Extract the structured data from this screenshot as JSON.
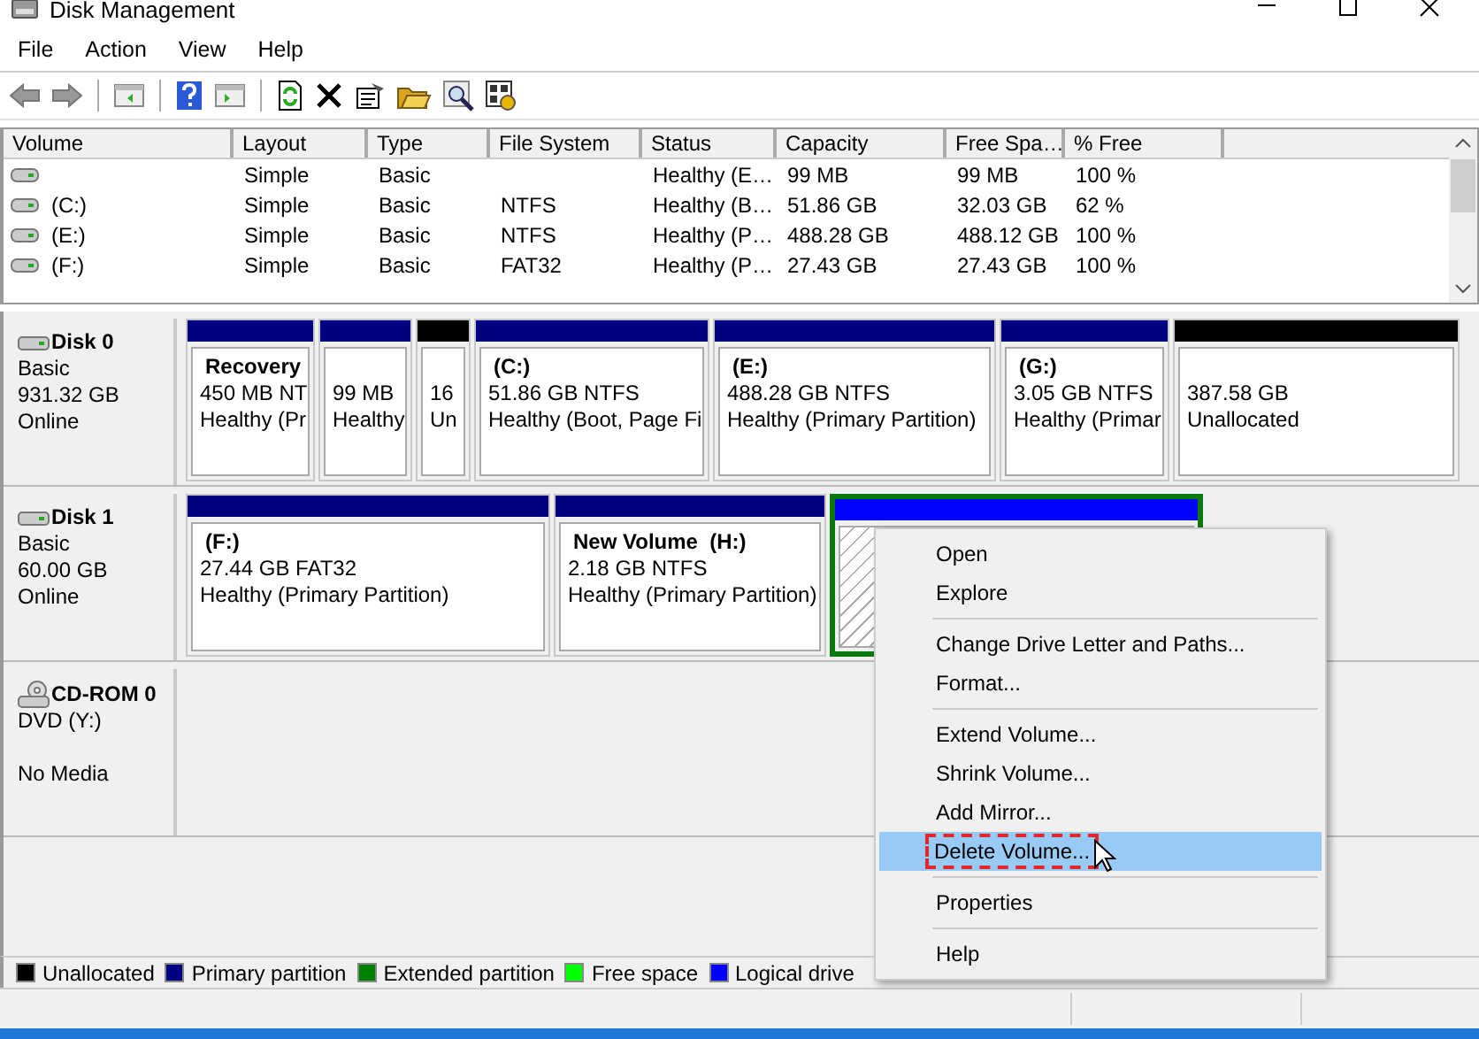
{
  "window": {
    "title": "Disk Management"
  },
  "menu": [
    "File",
    "Action",
    "View",
    "Help"
  ],
  "volume_list": {
    "columns": [
      "Volume",
      "Layout",
      "Type",
      "File System",
      "Status",
      "Capacity",
      "Free Spa…",
      "% Free"
    ],
    "rows": [
      [
        "",
        "Simple",
        "Basic",
        "",
        "Healthy (E…",
        "99 MB",
        "99 MB",
        "100 %"
      ],
      [
        "(C:)",
        "Simple",
        "Basic",
        "NTFS",
        "Healthy (B…",
        "51.86 GB",
        "32.03 GB",
        "62 %"
      ],
      [
        "(E:)",
        "Simple",
        "Basic",
        "NTFS",
        "Healthy (P…",
        "488.28 GB",
        "488.12 GB",
        "100 %"
      ],
      [
        "(F:)",
        "Simple",
        "Basic",
        "FAT32",
        "Healthy (P…",
        "27.43 GB",
        "27.43 GB",
        "100 %"
      ]
    ]
  },
  "disks": [
    {
      "kind": "disk",
      "name": "Disk 0",
      "type": "Basic",
      "size": "931.32 GB",
      "status": "Online",
      "partitions": [
        {
          "kind": "primary",
          "color": "#000080",
          "title": "Recovery",
          "size": "450 MB NT",
          "status": "Healthy (Pr",
          "selected": false
        },
        {
          "kind": "primary",
          "color": "#000080",
          "size": "99 MB",
          "status": "Healthy",
          "selected": false
        },
        {
          "kind": "primary",
          "color": "#000000",
          "size": "16",
          "status": "Un",
          "selected": false
        },
        {
          "kind": "primary",
          "color": "#000080",
          "title": "(C:)",
          "size": "51.86 GB NTFS",
          "status": "Healthy (Boot, Page Fi",
          "selected": false
        },
        {
          "kind": "primary",
          "color": "#000080",
          "title": "(E:)",
          "size": "488.28 GB NTFS",
          "status": "Healthy (Primary Partition)",
          "selected": false
        },
        {
          "kind": "primary",
          "color": "#000080",
          "title": "(G:)",
          "size": "3.05 GB NTFS",
          "status": "Healthy (Primar",
          "selected": false
        },
        {
          "kind": "primary",
          "color": "#000000",
          "size": "387.58 GB",
          "status": "Unallocated",
          "selected": false
        }
      ]
    },
    {
      "kind": "disk",
      "name": "Disk 1",
      "type": "Basic",
      "size": "60.00 GB",
      "status": "Online",
      "partitions": [
        {
          "kind": "primary",
          "color": "#000080",
          "title": "(F:)",
          "size": "27.44 GB FAT32",
          "status": "Healthy (Primary Partition)",
          "selected": false
        },
        {
          "kind": "primary",
          "color": "#000080",
          "title": "New Volume  (H:)",
          "size": "2.18 GB NTFS",
          "status": "Healthy (Primary Partition)",
          "selected": false
        },
        {
          "kind": "logical",
          "color": "#0000ff",
          "selected": true
        }
      ]
    },
    {
      "kind": "cdrom",
      "name": "CD-ROM 0",
      "type": "DVD (Y:)",
      "status": "No Media"
    }
  ],
  "legend": [
    {
      "label": "Unallocated",
      "color": "#000000"
    },
    {
      "label": "Primary partition",
      "color": "#000080"
    },
    {
      "label": "Extended partition",
      "color": "#008000"
    },
    {
      "label": "Free space",
      "color": "#00ff00"
    },
    {
      "label": "Logical drive",
      "color": "#0000ff"
    }
  ],
  "context_menu": [
    [
      {
        "label": "Open",
        "selected": false
      },
      {
        "label": "Explore",
        "selected": false
      }
    ],
    [
      {
        "label": "Change Drive Letter and Paths...",
        "selected": false
      },
      {
        "label": "Format...",
        "selected": false
      }
    ],
    [
      {
        "label": "Extend Volume...",
        "selected": false
      },
      {
        "label": "Shrink Volume...",
        "selected": false
      },
      {
        "label": "Add Mirror...",
        "selected": false
      },
      {
        "label": "Delete Volume...",
        "selected": true
      }
    ],
    [
      {
        "label": "Properties",
        "selected": false
      }
    ],
    [
      {
        "label": "Help",
        "selected": false
      }
    ]
  ]
}
